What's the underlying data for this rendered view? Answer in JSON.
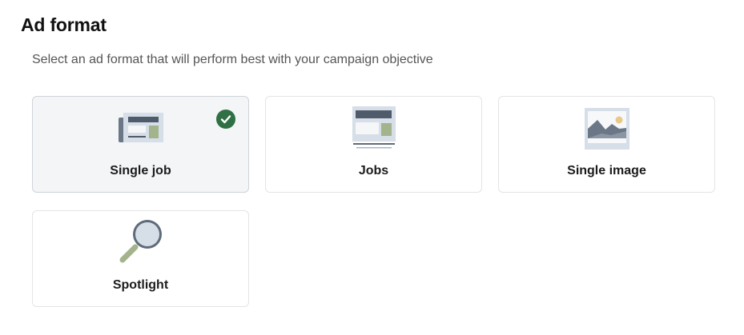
{
  "header": {
    "title": "Ad format",
    "subtitle": "Select an ad format that will perform best with your campaign objective"
  },
  "formats": [
    {
      "label": "Single job",
      "icon": "single-job-illustration-icon",
      "selected": true
    },
    {
      "label": "Jobs",
      "icon": "jobs-illustration-icon",
      "selected": false
    },
    {
      "label": "Single image",
      "icon": "single-image-illustration-icon",
      "selected": false
    },
    {
      "label": "Spotlight",
      "icon": "spotlight-magnifier-icon",
      "selected": false
    }
  ],
  "selected_indicator": {
    "icon": "checkmark-circle-icon",
    "color": "#2f7044"
  },
  "colors": {
    "selected_card_bg": "#f3f5f7",
    "card_border": "#e4e4e4",
    "illustration_slate": "#5f6b7a",
    "illustration_sage": "#a5b58f",
    "illustration_bg": "#d9e0e8"
  }
}
